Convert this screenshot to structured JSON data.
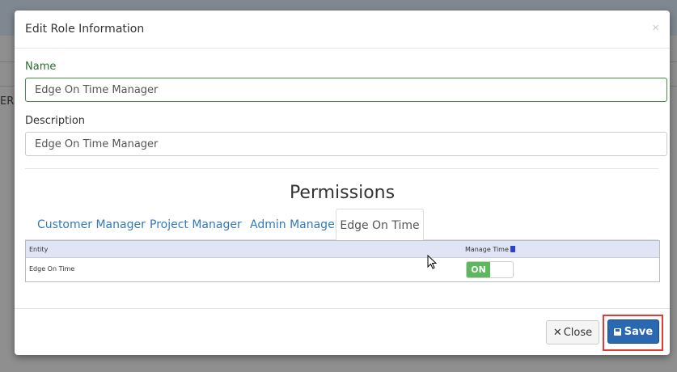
{
  "backdrop": {
    "partial_text": "ER"
  },
  "modal": {
    "title": "Edit Role Information",
    "close_glyph": "×",
    "name_label": "Name",
    "name_value": "Edge On Time Manager",
    "description_label": "Description",
    "description_value": "Edge On Time Manager",
    "permissions_title": "Permissions",
    "tabs": [
      {
        "label": "Customer Manager",
        "active": false
      },
      {
        "label": "Project Manager",
        "active": false
      },
      {
        "label": "Admin Manager",
        "active": false
      },
      {
        "label": "Edge On Time",
        "active": true
      }
    ],
    "table": {
      "headers": {
        "entity": "Entity",
        "manage_time": "Manage Time"
      },
      "rows": [
        {
          "entity": "Edge On Time",
          "manage_time": "ON"
        }
      ]
    },
    "buttons": {
      "close_label": "Close",
      "save_label": "Save"
    }
  },
  "colors": {
    "toggle_on": "#5cb85c",
    "save_button": "#2a68b0",
    "highlight": "#e53935",
    "header_row": "#dfe5f5",
    "name_label": "#2d6a2d"
  },
  "icons": {
    "close": "times-icon",
    "save": "floppy-disk-icon",
    "delete": "trash-icon"
  }
}
